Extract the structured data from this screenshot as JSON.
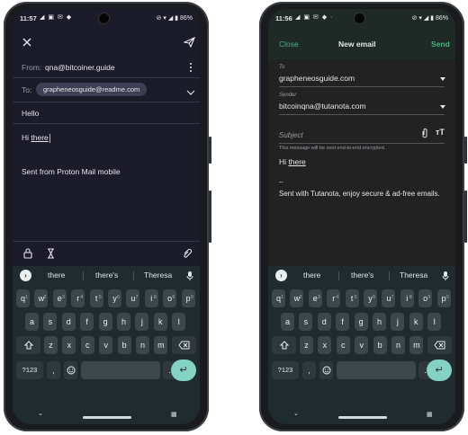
{
  "left": {
    "status": {
      "time": "11:57",
      "icons": "◢ ▣ ✉ ◆",
      "right": "⊘ ▾ ◢ ▮ 86%"
    },
    "from_label": "From:",
    "from_value": "qna@bitcoiner.guide",
    "to_label": "To:",
    "to_chip": "grapheneosguide@readme.com",
    "subject": "Hello",
    "body_hi": "Hi ",
    "body_word": "there",
    "signature": "Sent from Proton Mail mobile"
  },
  "right": {
    "status": {
      "time": "11:56",
      "icons": "◢ ▣ ✉ ◆ ·",
      "right": "⊘ ▾ ◢ ▮ 86%"
    },
    "close_label": "Close",
    "title": "New email",
    "send_label": "Send",
    "to_label": "To",
    "to_value": "grapheneosguide.com",
    "sender_label": "Sender",
    "sender_value": "bitcoinqna@tutanota.com",
    "subject_placeholder": "Subject",
    "encryption_note": "This message will be sent end-to-end encrypted.",
    "body_hi": "Hi ",
    "body_word": "there",
    "sig_dashes": "--",
    "signature": "Sent with Tutanota, enjoy secure & ad-free emails."
  },
  "keyboard": {
    "suggestions": [
      "there",
      "there's",
      "Theresa"
    ],
    "row1": [
      "q",
      "w",
      "e",
      "r",
      "t",
      "y",
      "u",
      "i",
      "o",
      "p"
    ],
    "row1_nums": [
      "1",
      "2",
      "3",
      "4",
      "5",
      "6",
      "7",
      "8",
      "9",
      "0"
    ],
    "row2": [
      "a",
      "s",
      "d",
      "f",
      "g",
      "h",
      "j",
      "k",
      "l"
    ],
    "row3": [
      "z",
      "x",
      "c",
      "v",
      "b",
      "n",
      "m"
    ],
    "sym_key": "?123",
    "comma": ",",
    "period": "."
  },
  "icons": {
    "close": "close-icon",
    "send": "send-icon",
    "more": "more-vert-icon",
    "expand": "chevron-down-icon",
    "lock": "lock-icon",
    "hourglass": "hourglass-icon",
    "attach": "attach-icon",
    "text_format": "text-format-icon",
    "mic": "mic-icon",
    "shift": "shift-icon",
    "backspace": "backspace-icon",
    "emoji": "emoji-icon",
    "enter": "enter-icon"
  }
}
